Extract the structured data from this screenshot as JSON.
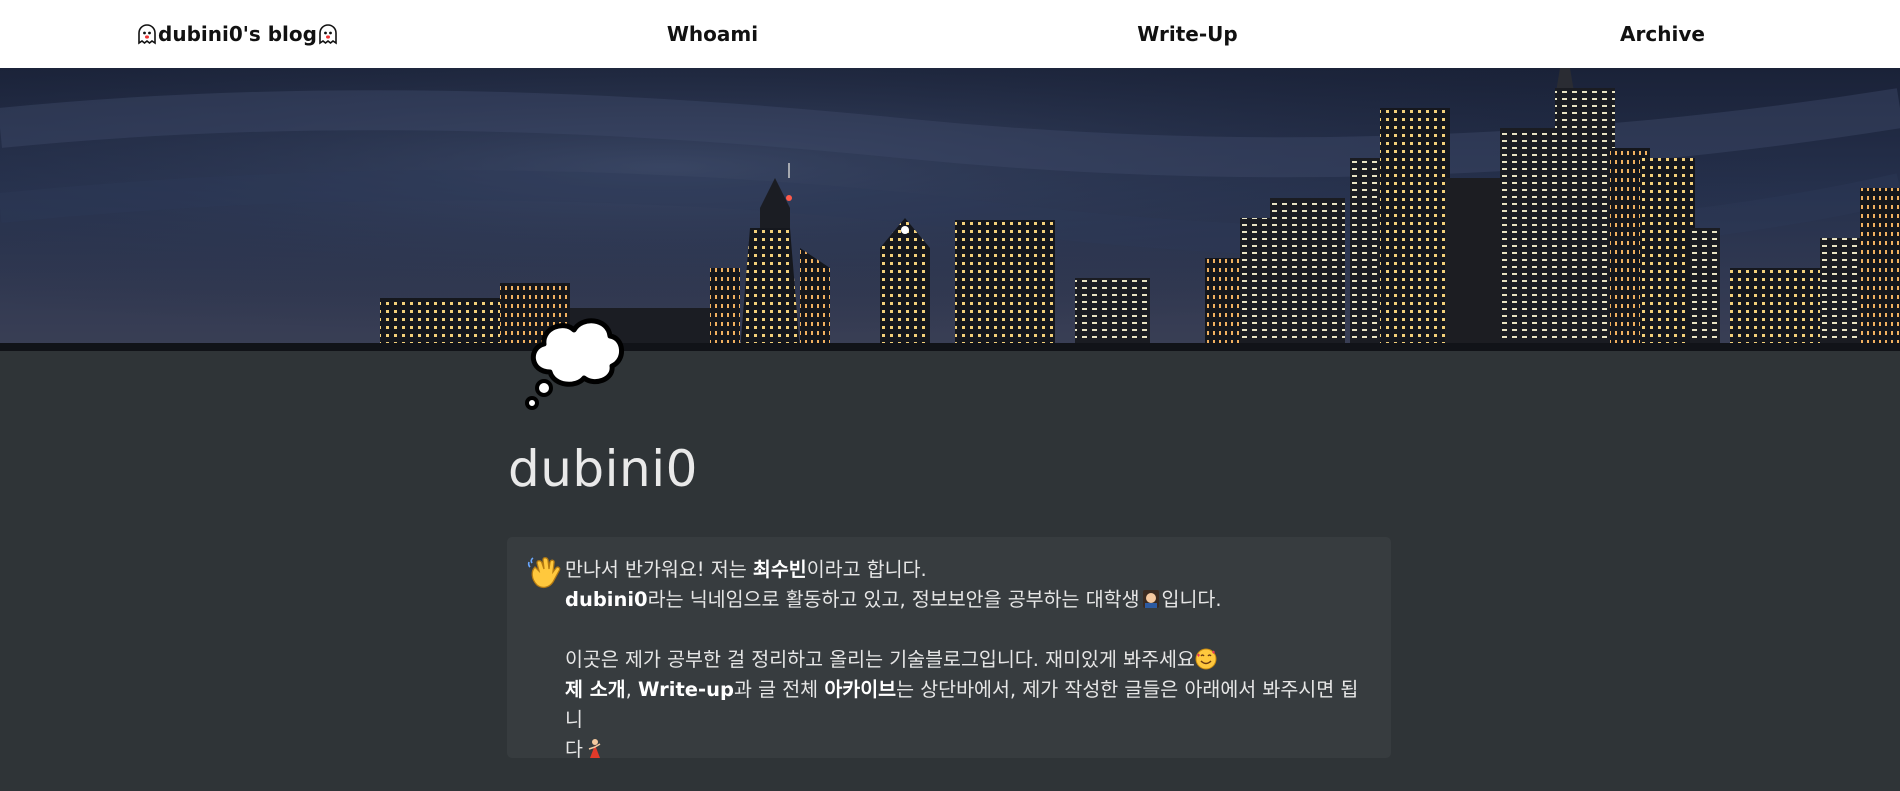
{
  "nav": {
    "brand_label": "dubini0's blog",
    "brand_icon": "ghost-icon",
    "items": [
      {
        "label": "Whoami"
      },
      {
        "label": "Write-Up"
      },
      {
        "label": "Archive"
      }
    ]
  },
  "cover": {
    "description_icon": "city-skyline-night"
  },
  "page": {
    "icon": "thought-balloon-icon",
    "title": "dubini0"
  },
  "callout": {
    "icon": "waving-hand-icon",
    "line1_prefix": "만나서 반가워요! 저는 ",
    "line1_bold": "최수빈",
    "line1_suffix": "이라고 합니다.",
    "line2_bold": "dubini0",
    "line2_suffix": "라는 닉네임으로 활동하고 있고, 정보보안을 공부하는 대학생",
    "line2_end": "입니다.",
    "line3": "이곳은 제가 공부한 걸 정리하고 올리는 기술블로그입니다. 재미있게 봐주세요",
    "line4_bold1": "제 소개",
    "line4_sep": ", ",
    "line4_bold2": "Write-up",
    "line4_mid": "과 글 전체 ",
    "line4_bold3": "아카이브",
    "line4_suffix": "는 상단바에서, 제가 작성한 글들은 아래에서 봐주시면 됩니",
    "line5": "다",
    "emoji_student": "student-icon",
    "emoji_smile": "smiling-face-hearts-icon",
    "emoji_dancer": "dancer-icon"
  },
  "colors": {
    "background": "#2f3437",
    "nav_bg": "#ffffff",
    "callout_bg": "#373c3f",
    "title_text": "#e9e9e9"
  }
}
